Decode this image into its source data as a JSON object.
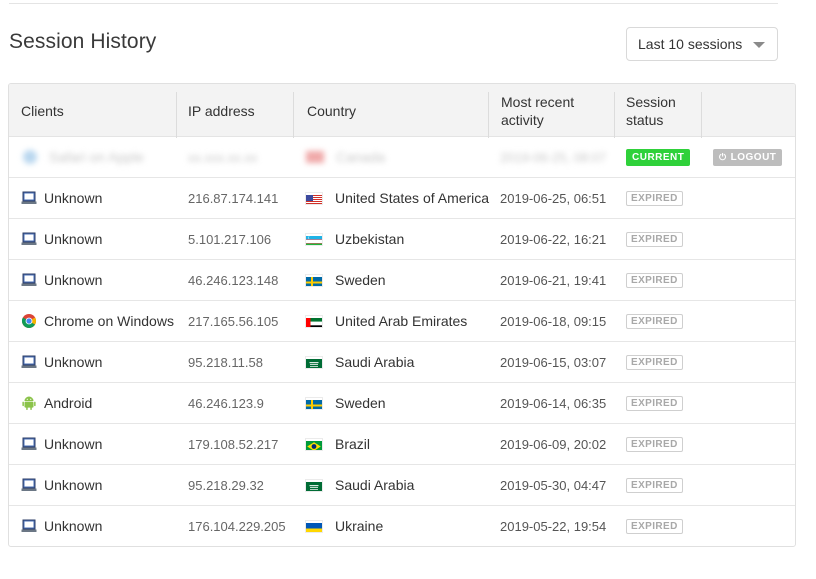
{
  "page": {
    "title": "Session History"
  },
  "filter": {
    "selected": "Last 10 sessions"
  },
  "table": {
    "headers": {
      "clients": "Clients",
      "ip": "IP address",
      "country": "Country",
      "activity_line1": "Most recent",
      "activity_line2": "activity",
      "status_line1": "Session",
      "status_line2": "status"
    },
    "current_session": {
      "client": "Safari on Apple",
      "ip": "xx.xxx.xx.xx",
      "country": "Canada",
      "date": "2019-06-25, 08:07",
      "status": "CURRENT",
      "action": "LOGOUT"
    },
    "rows": [
      {
        "client": "Unknown",
        "client_icon": "laptop-icon",
        "ip": "216.87.174.141",
        "country": "United States of America",
        "flag": "us",
        "date": "2019-06-25, 06:51",
        "status": "EXPIRED"
      },
      {
        "client": "Unknown",
        "client_icon": "laptop-icon",
        "ip": "5.101.217.106",
        "country": "Uzbekistan",
        "flag": "uz",
        "date": "2019-06-22, 16:21",
        "status": "EXPIRED"
      },
      {
        "client": "Unknown",
        "client_icon": "laptop-icon",
        "ip": "46.246.123.148",
        "country": "Sweden",
        "flag": "se",
        "date": "2019-06-21, 19:41",
        "status": "EXPIRED"
      },
      {
        "client": "Chrome on Windows",
        "client_icon": "chrome-icon",
        "ip": "217.165.56.105",
        "country": "United Arab Emirates",
        "flag": "ae",
        "date": "2019-06-18, 09:15",
        "status": "EXPIRED"
      },
      {
        "client": "Unknown",
        "client_icon": "laptop-icon",
        "ip": "95.218.11.58",
        "country": "Saudi Arabia",
        "flag": "sa",
        "date": "2019-06-15, 03:07",
        "status": "EXPIRED"
      },
      {
        "client": "Android",
        "client_icon": "android-icon",
        "ip": "46.246.123.9",
        "country": "Sweden",
        "flag": "se",
        "date": "2019-06-14, 06:35",
        "status": "EXPIRED"
      },
      {
        "client": "Unknown",
        "client_icon": "laptop-icon",
        "ip": "179.108.52.217",
        "country": "Brazil",
        "flag": "br",
        "date": "2019-06-09, 20:02",
        "status": "EXPIRED"
      },
      {
        "client": "Unknown",
        "client_icon": "laptop-icon",
        "ip": "95.218.29.32",
        "country": "Saudi Arabia",
        "flag": "sa",
        "date": "2019-05-30, 04:47",
        "status": "EXPIRED"
      },
      {
        "client": "Unknown",
        "client_icon": "laptop-icon",
        "ip": "176.104.229.205",
        "country": "Ukraine",
        "flag": "ua",
        "date": "2019-05-22, 19:54",
        "status": "EXPIRED"
      }
    ]
  },
  "colors": {
    "current_badge": "#2fd13a",
    "logout_button": "#bdbdbd",
    "header_bg": "#f3f3f3"
  }
}
